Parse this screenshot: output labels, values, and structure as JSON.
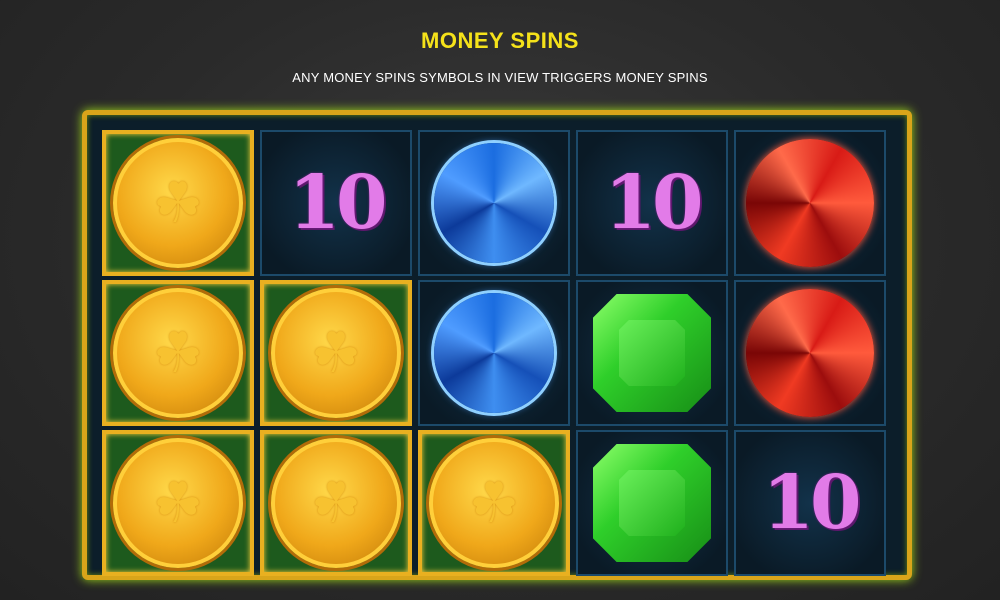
{
  "header": {
    "title": "MONEY SPINS",
    "subtitle": "ANY MONEY SPINS SYMBOLS IN VIEW TRIGGERS MONEY SPINS"
  },
  "colors": {
    "title": "#f5e21a",
    "frame": "#d9a51a"
  },
  "reels": [
    [
      "coin",
      "coin",
      "coin"
    ],
    [
      "ten",
      "coin",
      "coin"
    ],
    [
      "blue-gem",
      "blue-gem",
      "coin"
    ],
    [
      "ten",
      "green-gem",
      "green-gem"
    ],
    [
      "red-gem",
      "red-gem",
      "ten"
    ]
  ],
  "symbols": {
    "ten_label": "10"
  }
}
